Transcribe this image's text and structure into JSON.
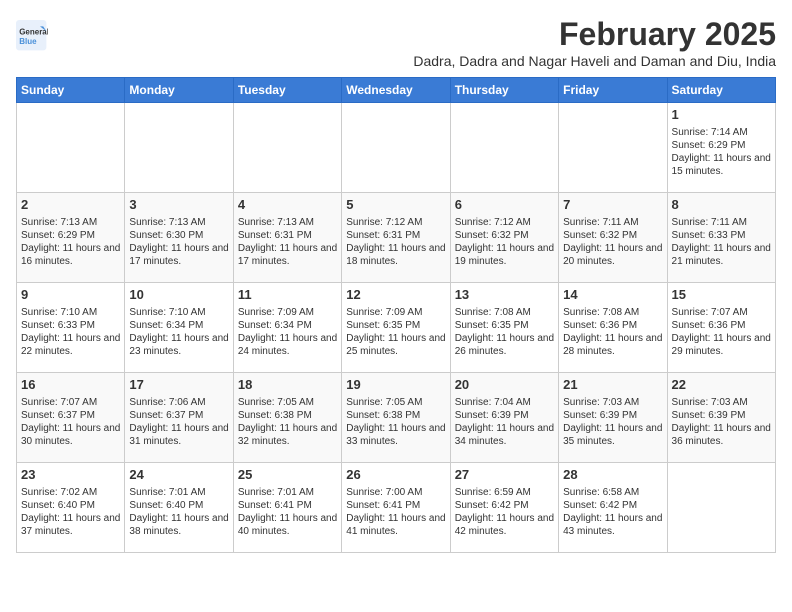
{
  "logo": {
    "line1": "General",
    "line2": "Blue"
  },
  "title": "February 2025",
  "subtitle": "Dadra, Dadra and Nagar Haveli and Daman and Diu, India",
  "days_of_week": [
    "Sunday",
    "Monday",
    "Tuesday",
    "Wednesday",
    "Thursday",
    "Friday",
    "Saturday"
  ],
  "weeks": [
    [
      {
        "num": "",
        "info": ""
      },
      {
        "num": "",
        "info": ""
      },
      {
        "num": "",
        "info": ""
      },
      {
        "num": "",
        "info": ""
      },
      {
        "num": "",
        "info": ""
      },
      {
        "num": "",
        "info": ""
      },
      {
        "num": "1",
        "info": "Sunrise: 7:14 AM\nSunset: 6:29 PM\nDaylight: 11 hours and 15 minutes."
      }
    ],
    [
      {
        "num": "2",
        "info": "Sunrise: 7:13 AM\nSunset: 6:29 PM\nDaylight: 11 hours and 16 minutes."
      },
      {
        "num": "3",
        "info": "Sunrise: 7:13 AM\nSunset: 6:30 PM\nDaylight: 11 hours and 17 minutes."
      },
      {
        "num": "4",
        "info": "Sunrise: 7:13 AM\nSunset: 6:31 PM\nDaylight: 11 hours and 17 minutes."
      },
      {
        "num": "5",
        "info": "Sunrise: 7:12 AM\nSunset: 6:31 PM\nDaylight: 11 hours and 18 minutes."
      },
      {
        "num": "6",
        "info": "Sunrise: 7:12 AM\nSunset: 6:32 PM\nDaylight: 11 hours and 19 minutes."
      },
      {
        "num": "7",
        "info": "Sunrise: 7:11 AM\nSunset: 6:32 PM\nDaylight: 11 hours and 20 minutes."
      },
      {
        "num": "8",
        "info": "Sunrise: 7:11 AM\nSunset: 6:33 PM\nDaylight: 11 hours and 21 minutes."
      }
    ],
    [
      {
        "num": "9",
        "info": "Sunrise: 7:10 AM\nSunset: 6:33 PM\nDaylight: 11 hours and 22 minutes."
      },
      {
        "num": "10",
        "info": "Sunrise: 7:10 AM\nSunset: 6:34 PM\nDaylight: 11 hours and 23 minutes."
      },
      {
        "num": "11",
        "info": "Sunrise: 7:09 AM\nSunset: 6:34 PM\nDaylight: 11 hours and 24 minutes."
      },
      {
        "num": "12",
        "info": "Sunrise: 7:09 AM\nSunset: 6:35 PM\nDaylight: 11 hours and 25 minutes."
      },
      {
        "num": "13",
        "info": "Sunrise: 7:08 AM\nSunset: 6:35 PM\nDaylight: 11 hours and 26 minutes."
      },
      {
        "num": "14",
        "info": "Sunrise: 7:08 AM\nSunset: 6:36 PM\nDaylight: 11 hours and 28 minutes."
      },
      {
        "num": "15",
        "info": "Sunrise: 7:07 AM\nSunset: 6:36 PM\nDaylight: 11 hours and 29 minutes."
      }
    ],
    [
      {
        "num": "16",
        "info": "Sunrise: 7:07 AM\nSunset: 6:37 PM\nDaylight: 11 hours and 30 minutes."
      },
      {
        "num": "17",
        "info": "Sunrise: 7:06 AM\nSunset: 6:37 PM\nDaylight: 11 hours and 31 minutes."
      },
      {
        "num": "18",
        "info": "Sunrise: 7:05 AM\nSunset: 6:38 PM\nDaylight: 11 hours and 32 minutes."
      },
      {
        "num": "19",
        "info": "Sunrise: 7:05 AM\nSunset: 6:38 PM\nDaylight: 11 hours and 33 minutes."
      },
      {
        "num": "20",
        "info": "Sunrise: 7:04 AM\nSunset: 6:39 PM\nDaylight: 11 hours and 34 minutes."
      },
      {
        "num": "21",
        "info": "Sunrise: 7:03 AM\nSunset: 6:39 PM\nDaylight: 11 hours and 35 minutes."
      },
      {
        "num": "22",
        "info": "Sunrise: 7:03 AM\nSunset: 6:39 PM\nDaylight: 11 hours and 36 minutes."
      }
    ],
    [
      {
        "num": "23",
        "info": "Sunrise: 7:02 AM\nSunset: 6:40 PM\nDaylight: 11 hours and 37 minutes."
      },
      {
        "num": "24",
        "info": "Sunrise: 7:01 AM\nSunset: 6:40 PM\nDaylight: 11 hours and 38 minutes."
      },
      {
        "num": "25",
        "info": "Sunrise: 7:01 AM\nSunset: 6:41 PM\nDaylight: 11 hours and 40 minutes."
      },
      {
        "num": "26",
        "info": "Sunrise: 7:00 AM\nSunset: 6:41 PM\nDaylight: 11 hours and 41 minutes."
      },
      {
        "num": "27",
        "info": "Sunrise: 6:59 AM\nSunset: 6:42 PM\nDaylight: 11 hours and 42 minutes."
      },
      {
        "num": "28",
        "info": "Sunrise: 6:58 AM\nSunset: 6:42 PM\nDaylight: 11 hours and 43 minutes."
      },
      {
        "num": "",
        "info": ""
      }
    ]
  ]
}
